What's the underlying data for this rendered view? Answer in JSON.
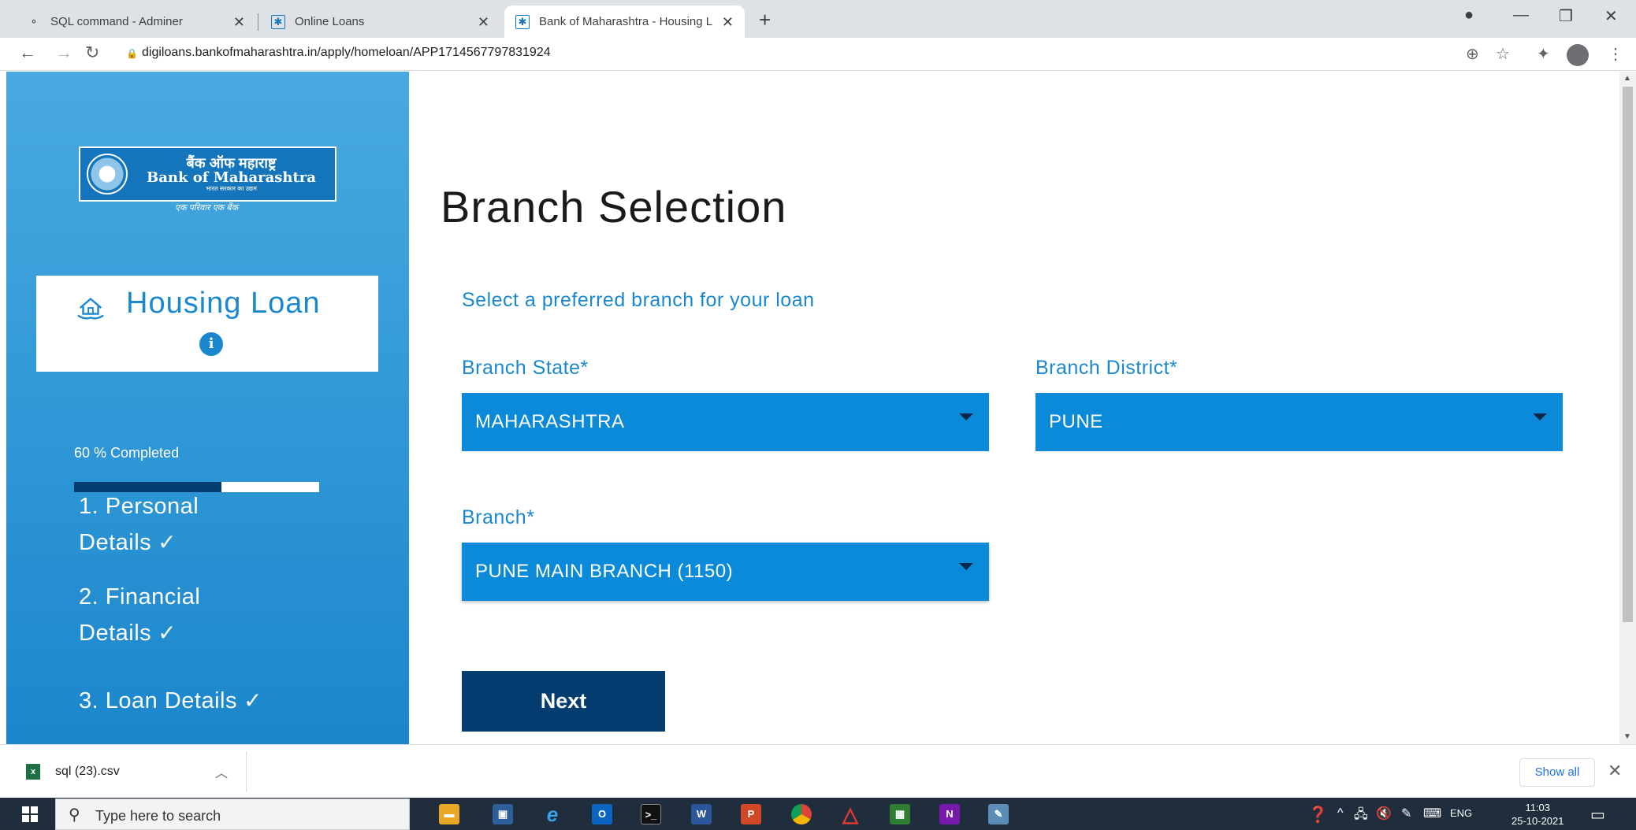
{
  "browser": {
    "tabs": [
      {
        "title": "SQL command - Adminer",
        "active": false
      },
      {
        "title": "Online Loans",
        "active": false
      },
      {
        "title": "Bank of Maharashtra - Housing L",
        "active": true
      }
    ],
    "url": "digiloans.bankofmaharashtra.in/apply/homeloan/APP1714567797831924"
  },
  "sidebar": {
    "logo": {
      "hindi": "बैंक ऑफ महाराष्ट्र",
      "english": "Bank of Maharashtra",
      "sub": "भारत सरकार का उद्यम",
      "tagline": "एक परिवार एक बैंक"
    },
    "loan_title": "Housing Loan",
    "info_glyph": "i",
    "progress_text": "60 % Completed",
    "progress_value": 0.6,
    "steps": [
      {
        "line1": "1. Personal",
        "line2": "Details",
        "check": "✓"
      },
      {
        "line1": "2. Financial",
        "line2": "Details",
        "check": "✓"
      },
      {
        "line1": "3. Loan Details",
        "line2": "",
        "check": "✓"
      }
    ]
  },
  "main": {
    "heading": "Branch Selection",
    "subheading": "Select a preferred branch for your loan",
    "state_label": "Branch State*",
    "state_value": "MAHARASHTRA",
    "district_label": "Branch District*",
    "district_value": "PUNE",
    "branch_label": "Branch*",
    "branch_value": "PUNE MAIN BRANCH (1150)",
    "next_label": "Next"
  },
  "downloads": {
    "file": "sql (23).csv",
    "show_all": "Show all"
  },
  "taskbar": {
    "search_placeholder": "Type here to search",
    "lang": "ENG",
    "time": "11:03",
    "date": "25-10-2021"
  },
  "colors": {
    "accent": "#1a88cf",
    "select_bg": "#0a8ad8",
    "button_bg": "#063d70",
    "sidebar_top": "#49a9e0",
    "sidebar_bottom": "#1b86cc"
  }
}
